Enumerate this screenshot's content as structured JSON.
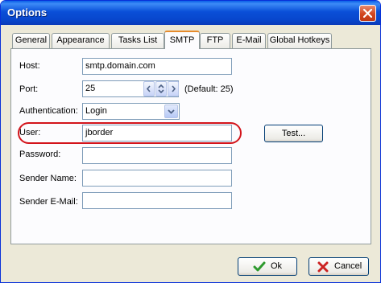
{
  "window": {
    "title": "Options"
  },
  "tabs": [
    {
      "label": "General",
      "active": false
    },
    {
      "label": "Appearance",
      "active": false
    },
    {
      "label": "Tasks List",
      "active": false
    },
    {
      "label": "SMTP",
      "active": true
    },
    {
      "label": "FTP",
      "active": false
    },
    {
      "label": "E-Mail",
      "active": false
    },
    {
      "label": "Global Hotkeys",
      "active": false
    }
  ],
  "smtp": {
    "host": {
      "label": "Host:",
      "value": "smtp.domain.com"
    },
    "port": {
      "label": "Port:",
      "value": "25",
      "default_note": "(Default: 25)"
    },
    "authentication": {
      "label": "Authentication:",
      "selected": "Login"
    },
    "user": {
      "label": "User:",
      "value": "jborder"
    },
    "password": {
      "label": "Password:",
      "value": ""
    },
    "sender_name": {
      "label": "Sender Name:",
      "value": ""
    },
    "sender_email": {
      "label": "Sender E-Mail:",
      "value": ""
    },
    "test_button": "Test..."
  },
  "buttons": {
    "ok": "Ok",
    "cancel": "Cancel"
  },
  "colors": {
    "highlight": "#d3141b",
    "title_bar": "#0a4fd8",
    "ok_check": "#2e9a2e",
    "cancel_x": "#cc2222"
  },
  "icons": {
    "ok": "check-icon",
    "cancel": "x-icon",
    "close": "close-icon"
  }
}
